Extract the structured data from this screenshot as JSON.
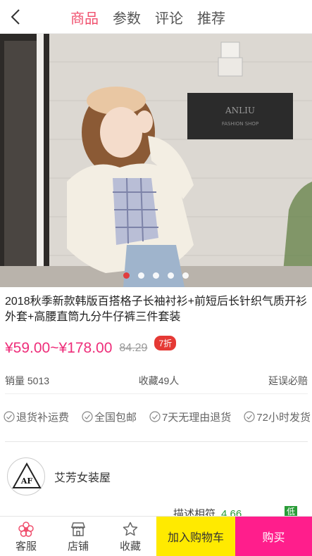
{
  "header": {
    "tabs": [
      {
        "label": "商品"
      },
      {
        "label": "参数"
      },
      {
        "label": "评论"
      },
      {
        "label": "推荐"
      }
    ],
    "active_color": "#f0506e"
  },
  "gallery": {
    "slide_count": 5,
    "active_index": 0,
    "sign_text": "ANLIU",
    "sign_subtext": "FASHION SHOP"
  },
  "product": {
    "title": "2018秋季新款韩版百搭格子长袖衬衫+前短后长针织气质开衫外套+高腰直筒九分牛仔裤三件套装",
    "price_range": "¥59.00~¥178.00",
    "original_price": "84.29",
    "discount_badge": "7折"
  },
  "stats": {
    "sales": "销量 5013",
    "favorites": "收藏49人",
    "delay": "延误必赔"
  },
  "services": [
    {
      "label": "退货补运费"
    },
    {
      "label": "全国包邮"
    },
    {
      "label": "7天无理由退货"
    },
    {
      "label": "72小时发货"
    }
  ],
  "shop": {
    "name": "艾芳女装屋",
    "logo_text": "AF",
    "rating_label": "描述相符",
    "rating_value": "4.66",
    "rating_tag": "低"
  },
  "bottom_bar": {
    "service_label": "客服",
    "store_label": "店铺",
    "favorite_label": "收藏",
    "cart_label": "加入购物车",
    "buy_label": "购买",
    "cart_color": "#ffea00",
    "buy_color": "#ff1e8c"
  }
}
